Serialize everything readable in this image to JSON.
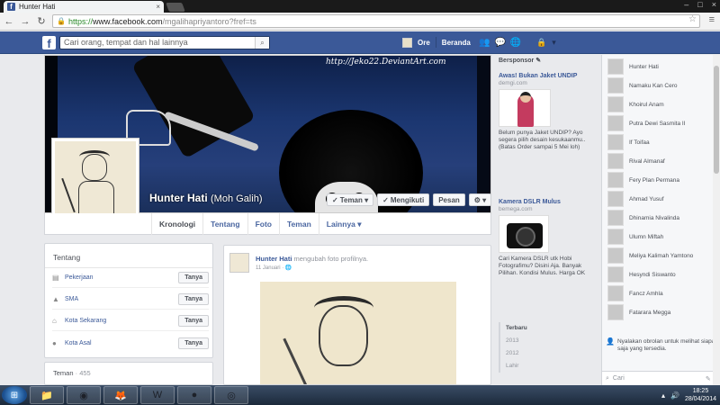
{
  "browser": {
    "tab_title": "Hunter Hati",
    "tab_close": "×",
    "url_scheme": "https://",
    "url_domain": "www.facebook.com",
    "url_path": "/mgalihapriyantoro?fref=ts",
    "back_icon": "←",
    "forward_icon": "→",
    "reload_icon": "↻",
    "star_icon": "☆",
    "menu_icon": "≡",
    "lock_icon": "🔒",
    "win_min": "–",
    "win_max": "□",
    "win_close": "×"
  },
  "fbbar": {
    "logo": "f",
    "search_placeholder": "Cari orang, tempat dan hal lainnya",
    "search_icon": "⌕",
    "user_name": "Ore",
    "home": "Beranda"
  },
  "cover": {
    "watermark": "http://Jeko22.DeviantArt.com"
  },
  "profile": {
    "name": "Hunter Hati",
    "alt_name": "(Moh Galih)",
    "buttons": {
      "friend": "Teman",
      "following": "Mengikuti",
      "message": "Pesan",
      "gear": "⚙"
    }
  },
  "tabs": [
    "Kronologi",
    "Tentang",
    "Foto",
    "Teman",
    "Lainnya"
  ],
  "about": {
    "title": "Tentang",
    "rows": [
      {
        "label": "Pekerjaan",
        "ask": "Tanya"
      },
      {
        "label": "SMA",
        "ask": "Tanya"
      },
      {
        "label": "Kota Sekarang",
        "ask": "Tanya"
      },
      {
        "label": "Kota Asal",
        "ask": "Tanya"
      }
    ]
  },
  "friends": {
    "title": "Teman",
    "count": "· 455"
  },
  "post": {
    "author": "Hunter Hati",
    "action": "mengubah foto profilnya.",
    "date": "11 Januari · "
  },
  "ads": {
    "header": "Bersponsor",
    "ad1": {
      "title": "Awas! Bukan Jaket UNDIP",
      "domain": "demgi.com",
      "body": "Belum punya Jaket UNDIP? Ayo segera pilih desain kesukaanmu.. (Batas Order sampai 5 Mei loh)"
    },
    "ad2": {
      "title": "Kamera DSLR Mulus",
      "domain": "bemega.com",
      "body": "Cari Kamera DSLR utk Hobi Fotografimu? Disini Aja. Banyak Pilihan. Kondisi Mulus. Harga OK"
    },
    "years": [
      "Terbaru",
      "2013",
      "2012",
      "Lahir"
    ]
  },
  "chat": {
    "people": [
      "Hunter Hati",
      "Namaku Kan Cero",
      "Khoirul Anam",
      "Putra Dewi Sasmita II",
      "If Toifaa",
      "Rival Almanaf",
      "Fery Plan Permana",
      "Ahmad Yusuf",
      "Dhinamia Nivalinda",
      "Ulumn Miftah",
      "Meliya Kalimah Yamtono",
      "Hesyndi Siswanto",
      "Fancz Amhla",
      "Fatarara Megga"
    ],
    "notice": "Nyalakan obrolan untuk melihat siapa saja yang tersedia.",
    "search": "Cari"
  },
  "taskbar": {
    "time": "18:25",
    "date": "28/04/2014"
  }
}
